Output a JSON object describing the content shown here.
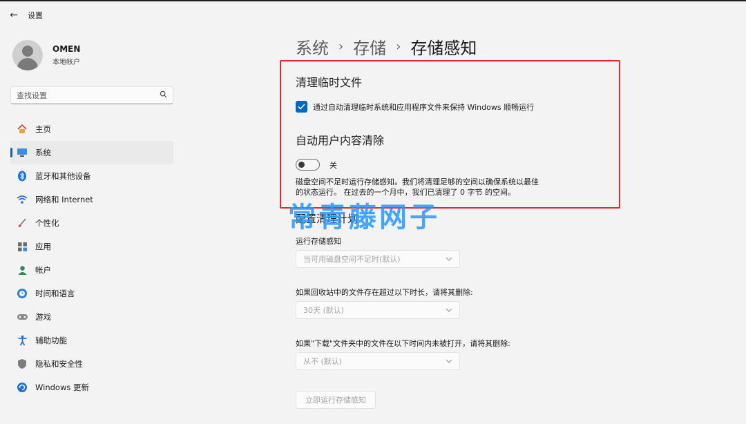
{
  "window": {
    "title": "设置",
    "back_glyph": "←"
  },
  "user": {
    "name": "OMEN",
    "account_type": "本地帐户"
  },
  "search": {
    "placeholder": "查找设置",
    "icon": "search-icon"
  },
  "nav": {
    "items": [
      {
        "label": "主页",
        "icon": "home-icon",
        "active": false
      },
      {
        "label": "系统",
        "icon": "monitor-icon",
        "active": true
      },
      {
        "label": "蓝牙和其他设备",
        "icon": "bluetooth-icon",
        "active": false
      },
      {
        "label": "网络和 Internet",
        "icon": "wifi-icon",
        "active": false
      },
      {
        "label": "个性化",
        "icon": "brush-icon",
        "active": false
      },
      {
        "label": "应用",
        "icon": "apps-icon",
        "active": false
      },
      {
        "label": "帐户",
        "icon": "person-icon",
        "active": false
      },
      {
        "label": "时间和语言",
        "icon": "globe-clock-icon",
        "active": false
      },
      {
        "label": "游戏",
        "icon": "gamepad-icon",
        "active": false
      },
      {
        "label": "辅助功能",
        "icon": "accessibility-icon",
        "active": false
      },
      {
        "label": "隐私和安全性",
        "icon": "shield-icon",
        "active": false
      },
      {
        "label": "Windows 更新",
        "icon": "update-icon",
        "active": false
      }
    ]
  },
  "breadcrumb": {
    "level1": "系统",
    "level2": "存储",
    "current": "存储感知",
    "separator": "›"
  },
  "cleanup_temp": {
    "title": "清理临时文件",
    "checkbox_label": "通过自动清理临时系统和应用程序文件来保持 Windows 顺畅运行",
    "checked": true
  },
  "auto_cleanup": {
    "title": "自动用户内容清除",
    "toggle_label": "关",
    "toggle_on": false,
    "description_line1": "磁盘空间不足时运行存储感知。我们将清理足够的空间以确保系统以最佳",
    "description_line2": "的状态运行。 在过去的一个月中，我们已清理了 0 字节 的空间。"
  },
  "watermark": "常青藤网子",
  "schedule": {
    "title": "配置清理计划",
    "run_label": "运行存储感知",
    "run_value": "当可用磁盘空间不足时(默认)",
    "recycle_label": "如果回收站中的文件存在超过以下时长，请将其删除:",
    "recycle_value": "30天 (默认)",
    "downloads_label": "如果\"下载\"文件夹中的文件在以下时间内未被打开，请将其删除:",
    "downloads_value": "从不 (默认)",
    "run_now_label": "立即运行存储感知"
  },
  "colors": {
    "accent": "#0067c0",
    "highlight": "#e8272a",
    "watermark": "#2696ff"
  }
}
